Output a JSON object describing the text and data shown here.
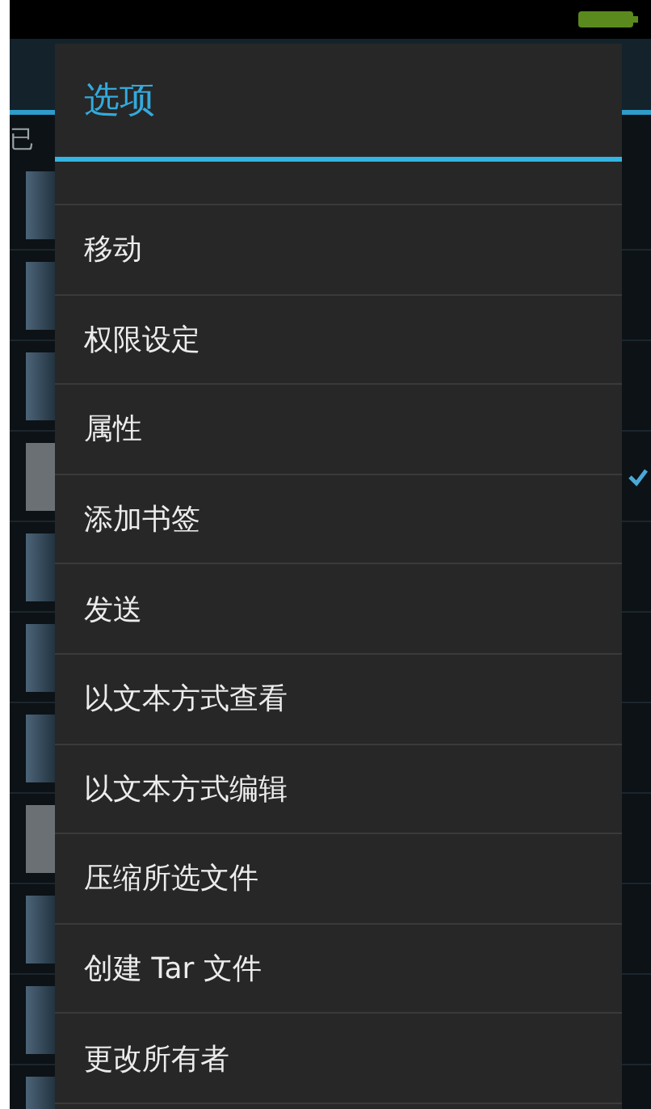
{
  "background": {
    "section_label": "已",
    "rows": [
      {
        "checked": false
      },
      {
        "checked": false
      },
      {
        "checked": false
      },
      {
        "checked": true
      },
      {
        "checked": false
      },
      {
        "checked": false
      },
      {
        "checked": false
      },
      {
        "checked": false
      },
      {
        "checked": false
      },
      {
        "checked": false
      },
      {
        "checked": false
      }
    ]
  },
  "dialog": {
    "title": "选项",
    "items": [
      "移动",
      "权限设定",
      "属性",
      "添加书签",
      "发送",
      "以文本方式查看",
      "以文本方式编辑",
      "压缩所选文件",
      "创建 Tar 文件",
      "更改所有者"
    ]
  }
}
